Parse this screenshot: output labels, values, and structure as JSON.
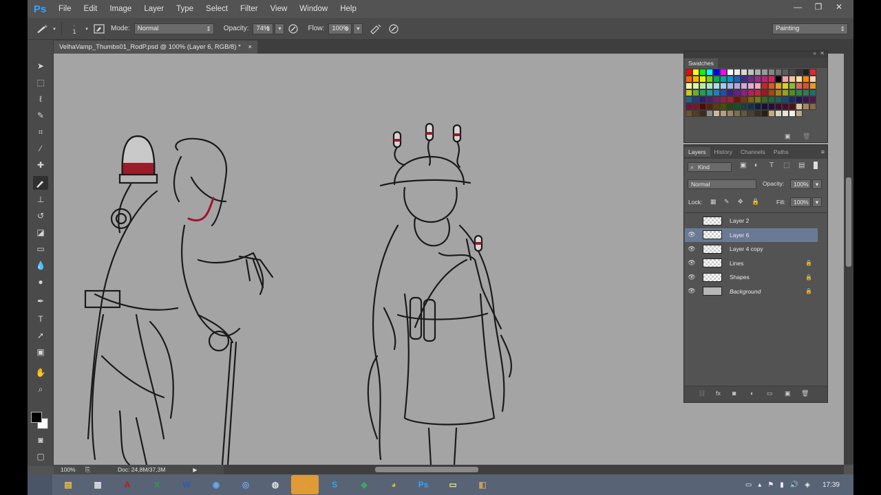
{
  "app": {
    "logo": "Ps"
  },
  "menu": [
    "File",
    "Edit",
    "Image",
    "Layer",
    "Type",
    "Select",
    "Filter",
    "View",
    "Window",
    "Help"
  ],
  "window_controls": {
    "minimize": "—",
    "restore": "❐",
    "close": "✕"
  },
  "options": {
    "brush_size": "1",
    "mode_label": "Mode:",
    "mode_value": "Normal",
    "opacity_label": "Opacity:",
    "opacity_value": "74%",
    "flow_label": "Flow:",
    "flow_value": "100%",
    "workspace": "Painting"
  },
  "document": {
    "tab_title": "VelhaVamp_Thumbs01_RodP.psd @ 100% (Layer 6, RGB/8) *",
    "tab_close": "×",
    "zoom": "100%",
    "doc_info": "Doc: 24,8M/37,3M"
  },
  "swatches_panel": {
    "tab": "Swatches",
    "colors": [
      "#ff0000",
      "#ffff00",
      "#00ff00",
      "#00ffff",
      "#0000ff",
      "#ff00ff",
      "#ffffff",
      "#ebebeb",
      "#d6d6d6",
      "#c2c2c2",
      "#adadad",
      "#999999",
      "#858585",
      "#707070",
      "#5c5c5c",
      "#474747",
      "#333333",
      "#1f1f1f",
      "#e8242a",
      "#ff6a00",
      "#ffb300",
      "#e6f200",
      "#7fd000",
      "#00b050",
      "#00a99d",
      "#0098d8",
      "#1f5fbf",
      "#3a2d8f",
      "#6a2d8f",
      "#9b2d8f",
      "#c0207a",
      "#e0205a",
      "#000000",
      "#f4a6a6",
      "#f7c59f",
      "#fbe09f",
      "#ff8800",
      "#f7d4b3",
      "#fff3a6",
      "#dff5a6",
      "#b9eba6",
      "#a6e6c9",
      "#a6e0e6",
      "#a6c9ef",
      "#a6b5e6",
      "#b5a6e0",
      "#cfa6e0",
      "#e6a6d4",
      "#f2a6bf",
      "#cc2222",
      "#e05522",
      "#e0a022",
      "#d8d022",
      "#88c022",
      "#e06666",
      "#d9541e",
      "#e89a1e",
      "#c8c81e",
      "#62b22e",
      "#1ea055",
      "#1e9a90",
      "#1e7fc0",
      "#1e50a8",
      "#3a1e8a",
      "#631e8a",
      "#921e80",
      "#b81e60",
      "#d01e3c",
      "#a01818",
      "#a84418",
      "#a88018",
      "#98a018",
      "#4e8e22",
      "#2e8844",
      "#2e7a5a",
      "#1e6e66",
      "#1e6298",
      "#1e3f86",
      "#2e1e70",
      "#4e1e70",
      "#741e66",
      "#931e4c",
      "#a81e30",
      "#781010",
      "#7e3210",
      "#7e6010",
      "#6e7a10",
      "#3a6a18",
      "#1e6a34",
      "#1e5e58",
      "#184a76",
      "#142e66",
      "#221456",
      "#3a1456",
      "#58144e",
      "#701438",
      "#7e1424",
      "#4e0a0a",
      "#54220a",
      "#54400a",
      "#485008",
      "#26460e",
      "#145022",
      "#14423e",
      "#10324e",
      "#0e1e44",
      "#160e38",
      "#260e38",
      "#3a0e34",
      "#4a0e24",
      "#540e18",
      "#d8c3a5",
      "#a8865a",
      "#8a6a42",
      "#6e5232",
      "#563e24",
      "#3e2c18",
      "#8c8c8c",
      "#cbb89a",
      "#b0a082",
      "#95876a",
      "#7b6f54",
      "#625840",
      "#4a422e",
      "#35301f",
      "#242013",
      "#c8a87c",
      "#d6d6c2",
      "#e8e4d6",
      "#f2efe6",
      "#b8a890"
    ]
  },
  "layers_panel": {
    "tabs": [
      "Layers",
      "History",
      "Channels",
      "Paths"
    ],
    "filter_kind": "Kind",
    "blend_mode": "Normal",
    "opacity_label": "Opacity:",
    "opacity_value": "100%",
    "lock_label": "Lock:",
    "fill_label": "Fill:",
    "fill_value": "100%",
    "layers": [
      {
        "name": "Layer 2",
        "visible": false,
        "locked": false,
        "selected": false,
        "italic": false
      },
      {
        "name": "Layer 6",
        "visible": true,
        "locked": false,
        "selected": true,
        "italic": false
      },
      {
        "name": "Layer 4 copy",
        "visible": true,
        "locked": false,
        "selected": false,
        "italic": false
      },
      {
        "name": "Lines",
        "visible": true,
        "locked": true,
        "selected": false,
        "italic": false
      },
      {
        "name": "Shapes",
        "visible": true,
        "locked": true,
        "selected": false,
        "italic": false
      },
      {
        "name": "Background",
        "visible": true,
        "locked": true,
        "selected": false,
        "italic": true
      }
    ]
  },
  "taskbar": {
    "apps": [
      {
        "name": "file-explorer",
        "glyph": "▤",
        "color": "#f0c040"
      },
      {
        "name": "notepad",
        "glyph": "▦",
        "color": "#dddddd"
      },
      {
        "name": "acrobat",
        "glyph": "A",
        "color": "#c01818"
      },
      {
        "name": "excel",
        "glyph": "X",
        "color": "#2e9b4a"
      },
      {
        "name": "word",
        "glyph": "W",
        "color": "#2a5db0"
      },
      {
        "name": "app-blue",
        "glyph": "◉",
        "color": "#6aa8f0"
      },
      {
        "name": "app-globe",
        "glyph": "◎",
        "color": "#6aa8f0"
      },
      {
        "name": "app-gray",
        "glyph": "◍",
        "color": "#e0e0e0"
      },
      {
        "name": "app-orange",
        "glyph": "●",
        "color": "#e89a3a"
      },
      {
        "name": "skype",
        "glyph": "S",
        "color": "#2fa8e8"
      },
      {
        "name": "app-green",
        "glyph": "◆",
        "color": "#3aa860"
      },
      {
        "name": "chrome",
        "glyph": "◕",
        "color": "#e8c030"
      },
      {
        "name": "photoshop",
        "glyph": "Ps",
        "color": "#2fa6ff"
      },
      {
        "name": "sticky-notes",
        "glyph": "▭",
        "color": "#f0e070"
      },
      {
        "name": "app-brown",
        "glyph": "◧",
        "color": "#c0a060"
      }
    ],
    "clock": "17:39"
  }
}
